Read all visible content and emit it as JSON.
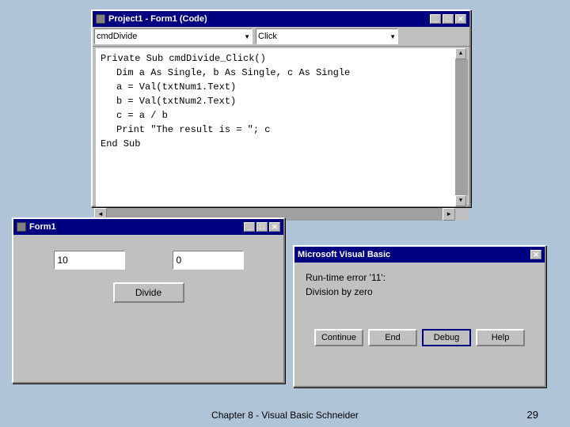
{
  "codeWindow": {
    "title": "Project1 - Form1 (Code)",
    "objectCombo": "cmdDivide",
    "procCombo": "Click",
    "code": [
      "Private Sub cmdDivide_Click()",
      "    Dim a As Single, b As Single, c As Single",
      "    a = Val(txtNum1.Text)",
      "    b = Val(txtNum2.Text)",
      "    c = a / b",
      "    Print \"The result is = \"; c",
      "End Sub"
    ],
    "winControls": [
      "_",
      "□",
      "✕"
    ]
  },
  "formWindow": {
    "title": "Form1",
    "input1Value": "10",
    "input2Value": "0",
    "buttonLabel": "Divide",
    "winControls": [
      "_",
      "□",
      "✕"
    ]
  },
  "errorDialog": {
    "title": "Microsoft Visual Basic",
    "line1": "Run-time error '11':",
    "line2": "Division by zero",
    "buttons": [
      "Continue",
      "End",
      "Debug",
      "Help"
    ],
    "winControls": [
      "✕"
    ]
  },
  "footer": {
    "text": "Chapter 8 - Visual Basic    Schneider",
    "page": "29"
  }
}
